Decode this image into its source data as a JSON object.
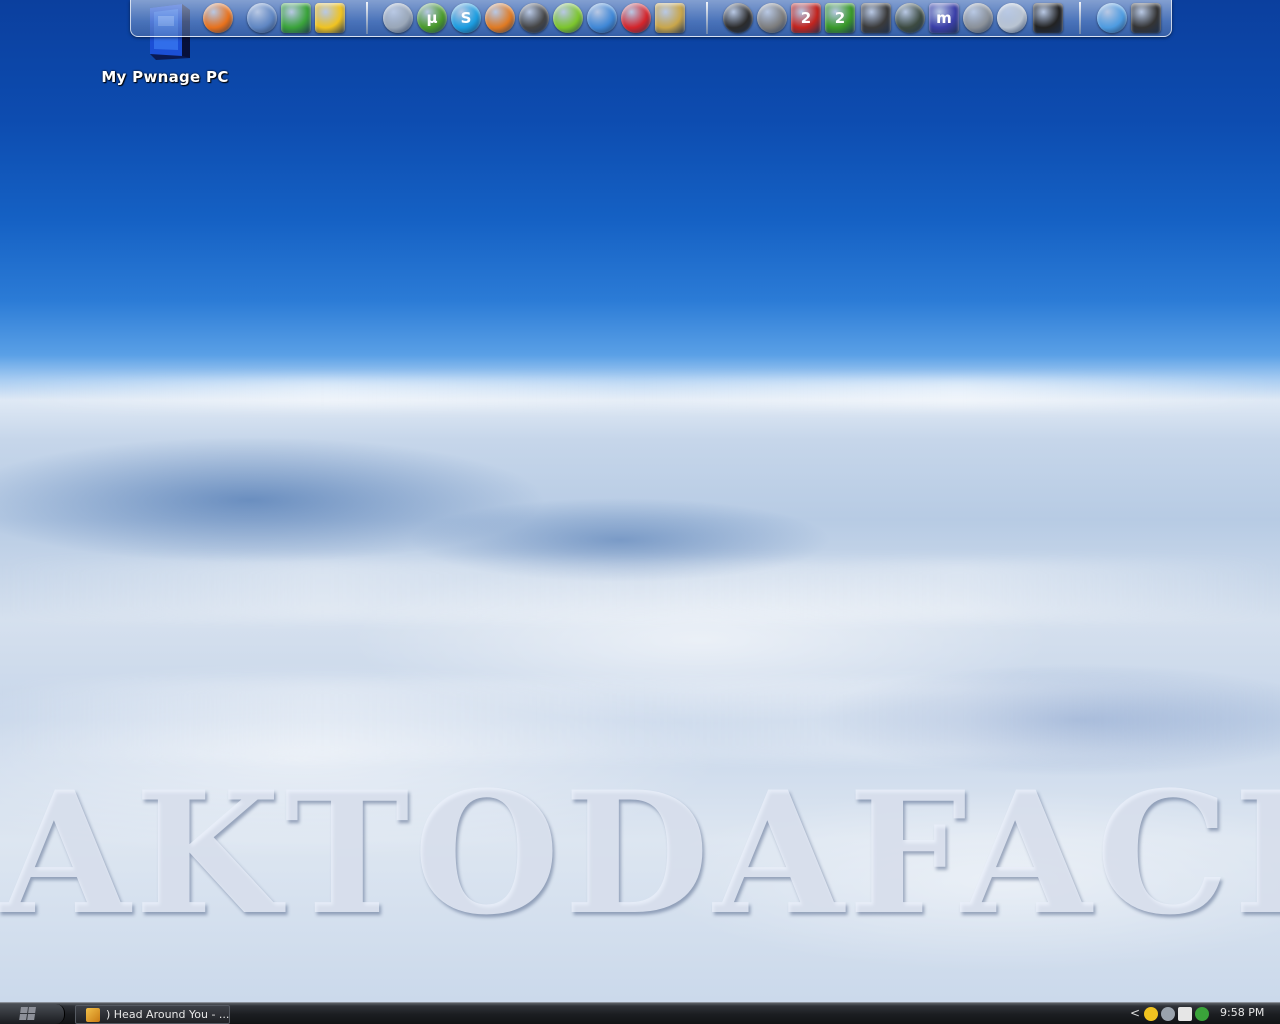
{
  "desktop": {
    "icon_label": "My Pwnage PC",
    "watermark": "AKTODAFACE"
  },
  "dock": {
    "icons": [
      {
        "name": "firefox-icon",
        "glyph": "",
        "color": "#e8711b"
      },
      {
        "name": "thunderbird-icon",
        "glyph": "",
        "color": "#5f86c2"
      },
      {
        "name": "msn-messenger-icon",
        "glyph": "",
        "color": "#3aa33a"
      },
      {
        "name": "aim-icon",
        "glyph": "",
        "color": "#f0c320"
      },
      {
        "name": "feather-icon",
        "glyph": "",
        "color": "#9aa7b8"
      },
      {
        "name": "utorrent-icon",
        "glyph": "µ",
        "color": "#4a9a2a"
      },
      {
        "name": "skype-icon",
        "glyph": "S",
        "color": "#1c9de0"
      },
      {
        "name": "media-player-icon",
        "glyph": "",
        "color": "#e07a22"
      },
      {
        "name": "winamp-icon",
        "glyph": "",
        "color": "#444444"
      },
      {
        "name": "limewire-icon",
        "glyph": "",
        "color": "#7cc52b"
      },
      {
        "name": "bird-icon",
        "glyph": "",
        "color": "#3f87d6"
      },
      {
        "name": "no-entry-icon",
        "glyph": "",
        "color": "#d4242a"
      },
      {
        "name": "cpu-icon",
        "glyph": "",
        "color": "#c9a64a"
      },
      {
        "name": "steam-icon",
        "glyph": "",
        "color": "#2b2b2b"
      },
      {
        "name": "counter-strike-icon",
        "glyph": "",
        "color": "#7d7d7d"
      },
      {
        "name": "battlefield-2-icon",
        "glyph": "2",
        "color": "#c2241e"
      },
      {
        "name": "battlefield-2-special-forces-icon",
        "glyph": "2",
        "color": "#3a9a2a"
      },
      {
        "name": "americas-army-icon",
        "glyph": "",
        "color": "#3a3a3a"
      },
      {
        "name": "game-icon",
        "glyph": "",
        "color": "#3c4a40"
      },
      {
        "name": "messenger-plus-icon",
        "glyph": "m",
        "color": "#3b3fa8"
      },
      {
        "name": "speaker-icon",
        "glyph": "",
        "color": "#8a9098"
      },
      {
        "name": "close-circle-icon",
        "glyph": "",
        "color": "#b9c4d2"
      },
      {
        "name": "monitor-icon",
        "glyph": "",
        "color": "#222222"
      },
      {
        "name": "safari-icon",
        "glyph": "",
        "color": "#4d9be0"
      },
      {
        "name": "recycle-bin-icon",
        "glyph": "",
        "color": "#333333"
      }
    ]
  },
  "taskbar": {
    "task_label": ") Head Around You - ...",
    "clock": "9:58 PM",
    "tray_arrow": "<"
  }
}
